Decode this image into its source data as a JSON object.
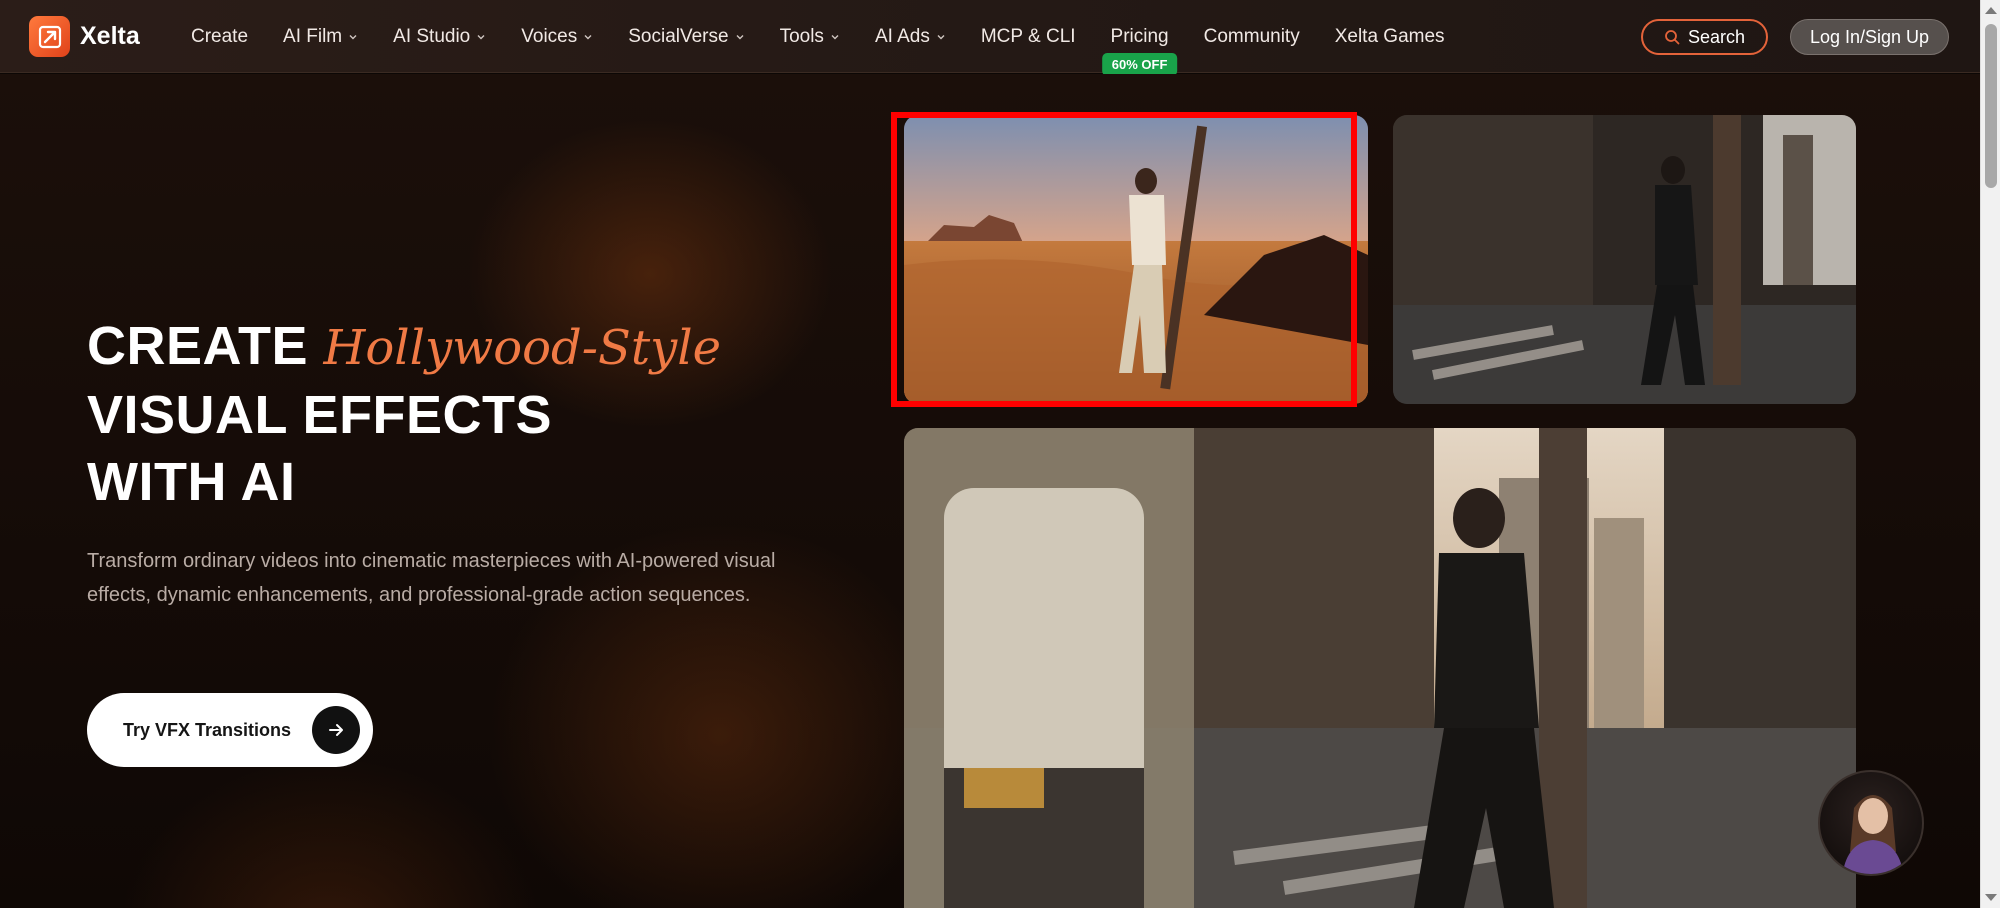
{
  "brand": {
    "name": "Xelta"
  },
  "nav": {
    "items": [
      {
        "label": "Create",
        "dropdown": false
      },
      {
        "label": "AI Film",
        "dropdown": true
      },
      {
        "label": "AI Studio",
        "dropdown": true
      },
      {
        "label": "Voices",
        "dropdown": true
      },
      {
        "label": "SocialVerse",
        "dropdown": true
      },
      {
        "label": "Tools",
        "dropdown": true
      },
      {
        "label": "AI Ads",
        "dropdown": true
      },
      {
        "label": "MCP & CLI",
        "dropdown": false
      },
      {
        "label": "Pricing",
        "dropdown": false,
        "badge": "60% OFF"
      },
      {
        "label": "Community",
        "dropdown": false
      },
      {
        "label": "Xelta Games",
        "dropdown": false
      }
    ],
    "search_label": "Search",
    "login_label": "Log In/Sign Up"
  },
  "hero": {
    "headline_word1": "CREATE",
    "headline_italic": "Hollywood-Style",
    "headline_line2": "VISUAL EFFECTS",
    "headline_line3": "WITH AI",
    "subtext": "Transform ordinary videos into cinematic masterpieces with AI-powered visual effects, dynamic enhancements, and professional-grade action sequences.",
    "cta_label": "Try VFX Transitions"
  },
  "colors": {
    "accent": "#f07a45",
    "badge_green": "#19a34a",
    "search_border": "#e4633a",
    "highlight_red": "#ff0000"
  },
  "icons": {
    "logo": "xelta-logo-icon",
    "search": "search-icon",
    "cta_arrow": "arrow-right-icon",
    "dropdown": "chevron-down-icon"
  }
}
